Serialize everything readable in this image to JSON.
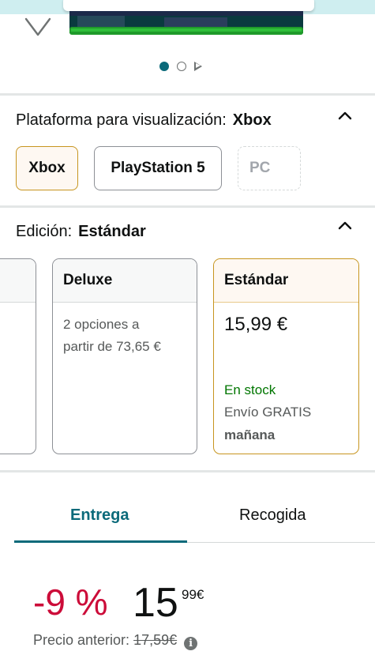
{
  "carousel": {
    "active_index": 0,
    "dot_count": 2,
    "has_play": true
  },
  "platform": {
    "label": "Plataforma para visualización:",
    "selected": "Xbox",
    "options": [
      {
        "label": "Xbox",
        "state": "selected"
      },
      {
        "label": "PlayStation 5",
        "state": "available"
      },
      {
        "label": "PC",
        "state": "unavailable"
      }
    ]
  },
  "edition": {
    "label": "Edición:",
    "selected": "Estándar",
    "cards": [
      {
        "name": "Deluxe",
        "details": [
          "2 opciones a",
          "partir de 73,65 €"
        ]
      },
      {
        "name": "Estándar",
        "price": "15,99 €",
        "stock": "En stock",
        "shipping": "Envío GRATIS",
        "shipping_day": "mañana"
      }
    ]
  },
  "delivery_tabs": {
    "active": "Entrega",
    "tabs": [
      "Entrega",
      "Recogida"
    ]
  },
  "pricing": {
    "discount": "-9 %",
    "price_whole": "15",
    "price_fraction": "99",
    "currency": "€",
    "previous_label": "Precio anterior:",
    "previous_price": "17,59€"
  },
  "colors": {
    "accent_teal": "#0b6a7a",
    "selected_border": "#c7951f",
    "discount_red": "#cc0c39",
    "in_stock_green": "#007600"
  },
  "icons": [
    "heart-icon",
    "chevron-up-icon",
    "info-icon",
    "play-icon"
  ]
}
